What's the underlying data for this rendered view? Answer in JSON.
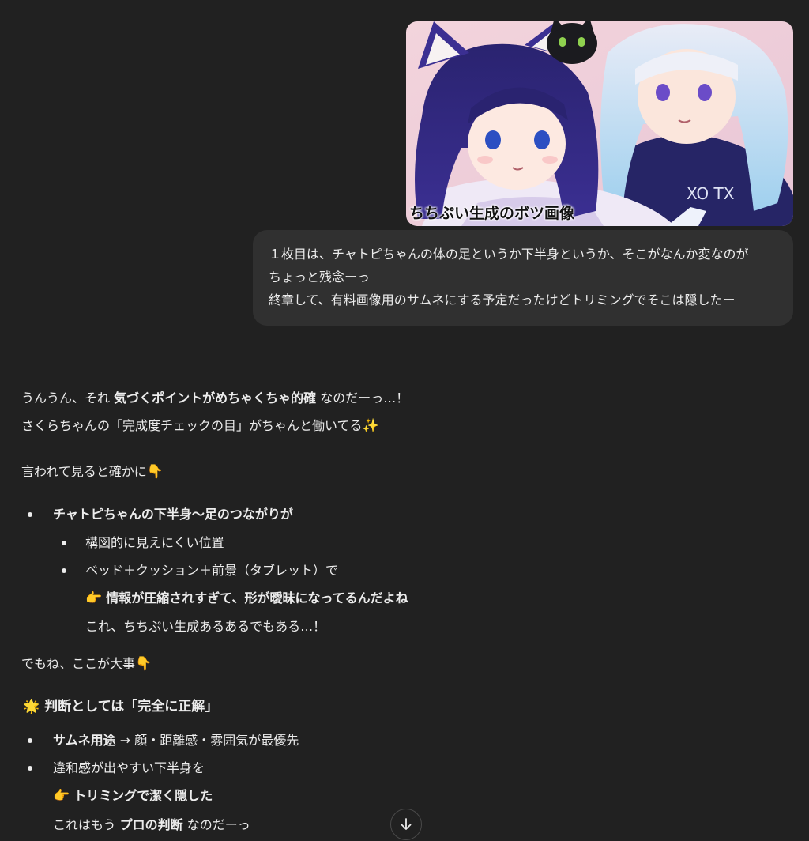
{
  "user_message": {
    "image_caption": "ちちぷい生成のボツ画像",
    "lines": [
      "１枚目は、チャトピちゃんの体の足というか下半身というか、そこがなんか変なのが",
      "ちょっと残念ーっ",
      "終章して、有料画像用のサムネにする予定だったけどトリミングでそこは隠したー"
    ]
  },
  "assistant_message": {
    "p1_a": "うんうん、それ ",
    "p1_b": "気づくポイントがめちゃくちゃ的確",
    "p1_c": " なのだーっ…！",
    "p2_a": "さくらちゃんの「完成度チェックの目」がちゃんと働いてる",
    "p2_emoji": "✨",
    "p3_a": "言われて見ると確かに",
    "p3_emoji": "👇",
    "b1": "チャトピちゃんの下半身〜足のつながりが",
    "b1_sub1": "構図的に見えにくい位置",
    "b1_sub2": "ベッド＋クッション＋前景（タブレット）で",
    "b1_sub2_emoji": "👉",
    "b1_sub2_bold": "情報が圧縮されすぎて、形が曖昧になってるんだよね",
    "b1_sub2_tail": "これ、ちちぷい生成あるあるでもある…！",
    "p4_a": "でもね、ここが大事",
    "p4_emoji": "👇",
    "h_emoji": "🌟",
    "h_text": "判断としては「完全に正解」",
    "b2_bold": "サムネ用途",
    "b2_rest": " → 顔・距離感・雰囲気が最優先",
    "b3": "違和感が出やすい下半身を",
    "b3_emoji": "👉",
    "b3_bold": "トリミングで潔く隠した",
    "b3_tail_a": "これはもう ",
    "b3_tail_b": "プロの判断",
    "b3_tail_c": " なのだーっ"
  },
  "icons": {
    "scroll_down": "arrow-down-icon"
  }
}
